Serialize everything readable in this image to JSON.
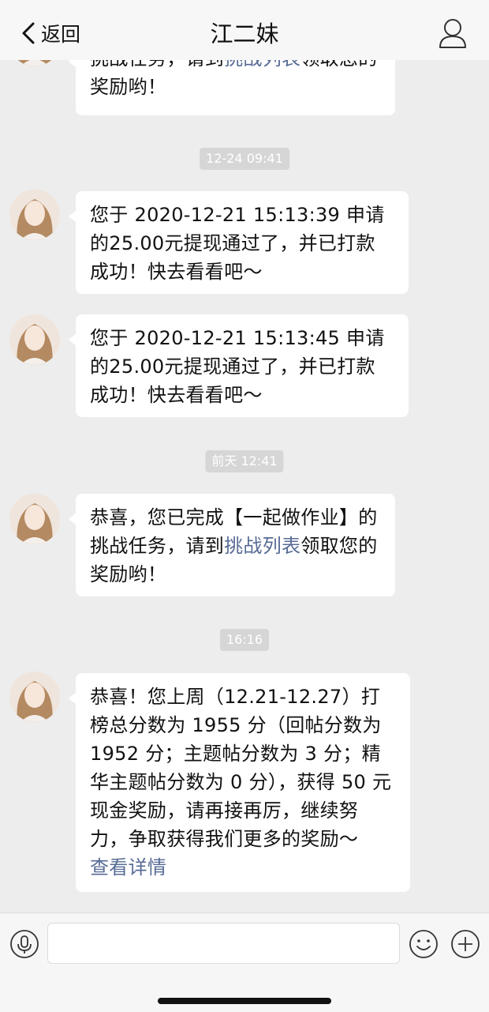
{
  "header": {
    "back_label": "返回",
    "title": "江二妹"
  },
  "messages": [
    {
      "type": "text",
      "parts": [
        {
          "text": "挑战任务，请到"
        },
        {
          "text": "挑战列表",
          "link": true
        },
        {
          "text": "领取您的奖励哟！"
        }
      ]
    },
    {
      "type": "timestamp",
      "text": "12-24 09:41"
    },
    {
      "type": "text",
      "parts": [
        {
          "text": "您于 2020-12-21 15:13:39 申请的25.00元提现通过了，并已打款成功！快去看看吧～"
        }
      ]
    },
    {
      "type": "text",
      "parts": [
        {
          "text": "您于 2020-12-21 15:13:45 申请的25.00元提现通过了，并已打款成功！快去看看吧～"
        }
      ]
    },
    {
      "type": "timestamp",
      "text": "前天 12:41"
    },
    {
      "type": "text",
      "parts": [
        {
          "text": "恭喜，您已完成【一起做作业】的挑战任务，请到"
        },
        {
          "text": "挑战列表",
          "link": true
        },
        {
          "text": "领取您的奖励哟！"
        }
      ]
    },
    {
      "type": "timestamp",
      "text": "16:16"
    },
    {
      "type": "text",
      "parts": [
        {
          "text": "恭喜！您上周（12.21-12.27）打榜总分数为 1955 分（回帖分数为 1952 分；主题帖分数为 3 分；精华主题帖分数为 0 分），获得 50 元现金奖励，请再接再厉，继续努力，争取获得我们更多的奖励～"
        },
        {
          "text": "查看详情",
          "link": true
        }
      ]
    }
  ],
  "input_bar": {
    "placeholder": "",
    "voice_icon": "microphone-icon",
    "emoji_icon": "smiley-icon",
    "plus_icon": "plus-circle-icon"
  },
  "colors": {
    "background": "#ededed",
    "bubble": "#ffffff",
    "link": "#576b95",
    "timestamp_bg": "#d6d6d6"
  }
}
